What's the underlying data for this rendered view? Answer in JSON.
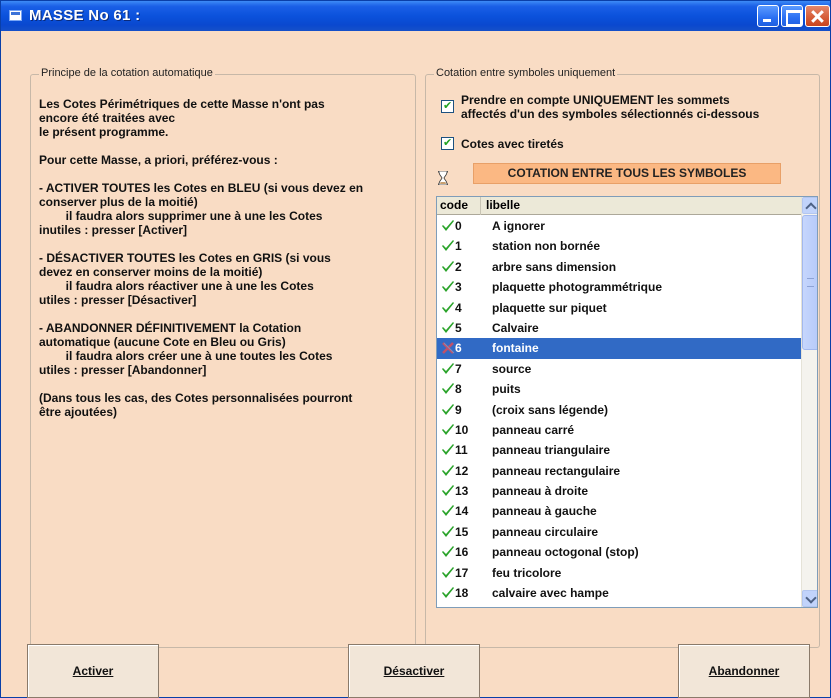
{
  "window": {
    "title": "MASSE No 61 :"
  },
  "principle": {
    "legend": "Principe de la cotation automatique",
    "text": "Les Cotes Périmétriques de cette Masse n'ont pas\nencore été traitées avec\nle présent programme.\n\nPour cette Masse, a priori, préférez-vous :\n\n- ACTIVER TOUTES les Cotes en BLEU (si vous devez en\nconserver plus de la moitié)\n        il faudra alors supprimer une à une les Cotes\ninutiles : presser [Activer]\n\n- DÉSACTIVER TOUTES les Cotes en GRIS (si vous\ndevez en conserver moins de la moitié)\n        il faudra alors réactiver une à une les Cotes\nutiles : presser [Désactiver]\n\n- ABANDONNER DÉFINITIVEMENT la Cotation\nautomatique (aucune Cote en Bleu ou Gris)\n        il faudra alors créer une à une toutes les Cotes\nutiles : presser [Abandonner]\n\n(Dans tous les cas, des Cotes personnalisées pourront\nêtre ajoutées)"
  },
  "symbols": {
    "legend": "Cotation entre symboles uniquement",
    "checkbox_only_label": "Prendre en compte UNIQUEMENT les sommets\naffectés d'un des symboles sélectionnés ci-dessous",
    "checkbox_only_checked": true,
    "checkbox_dashes_label": "Cotes avec tiretés",
    "checkbox_dashes_checked": true,
    "all_symbols_button": "COTATION ENTRE TOUS LES SYMBOLES",
    "list": {
      "header_code": "code",
      "header_libelle": "libelle",
      "rows": [
        {
          "code": "0",
          "libelle": "A ignorer",
          "checked": true
        },
        {
          "code": "1",
          "libelle": "station non bornée",
          "checked": true
        },
        {
          "code": "2",
          "libelle": "arbre sans dimension",
          "checked": true
        },
        {
          "code": "3",
          "libelle": "plaquette photogrammétrique",
          "checked": true
        },
        {
          "code": "4",
          "libelle": "plaquette sur piquet",
          "checked": true
        },
        {
          "code": "5",
          "libelle": "Calvaire",
          "checked": true
        },
        {
          "code": "6",
          "libelle": "fontaine",
          "checked": false,
          "selected": true
        },
        {
          "code": "7",
          "libelle": "source",
          "checked": true
        },
        {
          "code": "8",
          "libelle": "puits",
          "checked": true
        },
        {
          "code": "9",
          "libelle": "(croix sans légende)",
          "checked": true
        },
        {
          "code": "10",
          "libelle": "panneau carré",
          "checked": true
        },
        {
          "code": "11",
          "libelle": "panneau triangulaire",
          "checked": true
        },
        {
          "code": "12",
          "libelle": "panneau rectangulaire",
          "checked": true
        },
        {
          "code": "13",
          "libelle": "panneau à droite",
          "checked": true
        },
        {
          "code": "14",
          "libelle": "panneau à gauche",
          "checked": true
        },
        {
          "code": "15",
          "libelle": "panneau circulaire",
          "checked": true
        },
        {
          "code": "16",
          "libelle": "panneau octogonal (stop)",
          "checked": true
        },
        {
          "code": "17",
          "libelle": "feu tricolore",
          "checked": true
        },
        {
          "code": "18",
          "libelle": "calvaire avec hampe",
          "checked": true
        }
      ]
    }
  },
  "buttons": {
    "activer": "Activer",
    "desactiver": "Désactiver",
    "abandonner": "Abandonner"
  },
  "colors": {
    "window_bg": "#f9dcc4",
    "selection": "#316ac5",
    "accent_button": "#fbb883",
    "check_green": "#21a121"
  }
}
